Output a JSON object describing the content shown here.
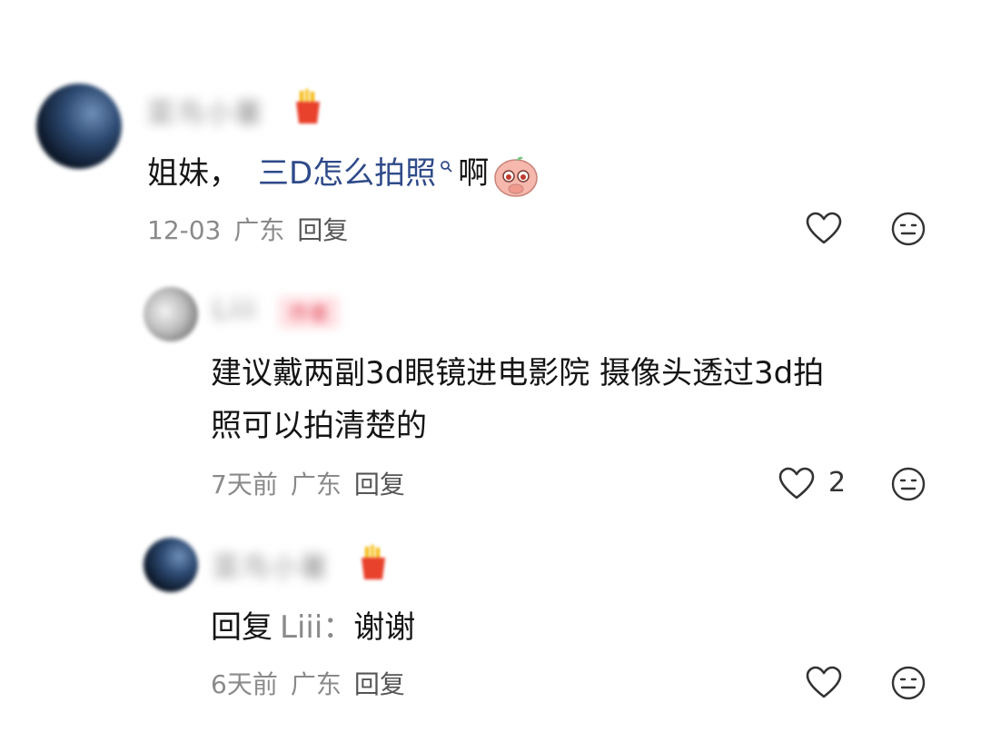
{
  "comments": [
    {
      "username": "菜鸟小薯",
      "text_plain": "姐妹，",
      "text_keyword": "三D怎么拍照",
      "text_after": "啊",
      "time": "12-03",
      "location": "广东",
      "reply_label": "回复"
    },
    {
      "username": "Liii",
      "badge": "作者",
      "line1": "建议戴两副3d眼镜进电影院 摄像头透过3d拍",
      "line2": "照可以拍清楚的",
      "time": "7天前",
      "location": "广东",
      "reply_label": "回复",
      "likes": "2"
    },
    {
      "username": "菜鸟小薯",
      "reply_prefix": "回复",
      "reply_target": "Liii：",
      "text": "谢谢",
      "time": "6天前",
      "location": "广东",
      "reply_label": "回复"
    }
  ],
  "icons": {
    "like": "heart-outline-icon",
    "dislike": "neutral-face-icon",
    "badge": "french-fries-icon",
    "search": "search-icon",
    "emoji": "cute-blush-emoji"
  },
  "colors": {
    "keyword": "#2f4a8a",
    "meta": "#8a8a8a",
    "text": "#151515"
  }
}
